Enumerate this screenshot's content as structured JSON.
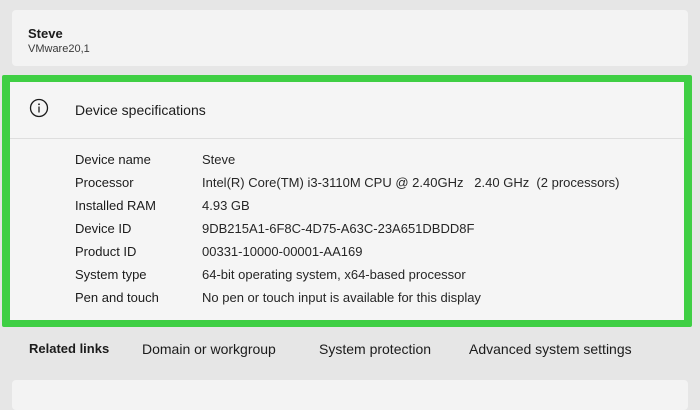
{
  "device": {
    "name": "Steve",
    "model": "VMware20,1"
  },
  "specs": {
    "title": "Device specifications",
    "icon": "info-icon",
    "rows": [
      {
        "label": "Device name",
        "value": "Steve"
      },
      {
        "label": "Processor",
        "value": "Intel(R) Core(TM) i3-3110M CPU @ 2.40GHz   2.40 GHz  (2 processors)"
      },
      {
        "label": "Installed RAM",
        "value": "4.93 GB"
      },
      {
        "label": "Device ID",
        "value": "9DB215A1-6F8C-4D75-A63C-23A651DBDD8F"
      },
      {
        "label": "Product ID",
        "value": "00331-10000-00001-AA169"
      },
      {
        "label": "System type",
        "value": "64-bit operating system, x64-based processor"
      },
      {
        "label": "Pen and touch",
        "value": "No pen or touch input is available for this display"
      }
    ]
  },
  "related": {
    "label": "Related links",
    "links": [
      "Domain or workgroup",
      "System protection",
      "Advanced system settings"
    ]
  },
  "colors": {
    "highlight": "#3fcf44",
    "card_background": "#f5f5f5",
    "page_background": "#e6e6e6"
  }
}
